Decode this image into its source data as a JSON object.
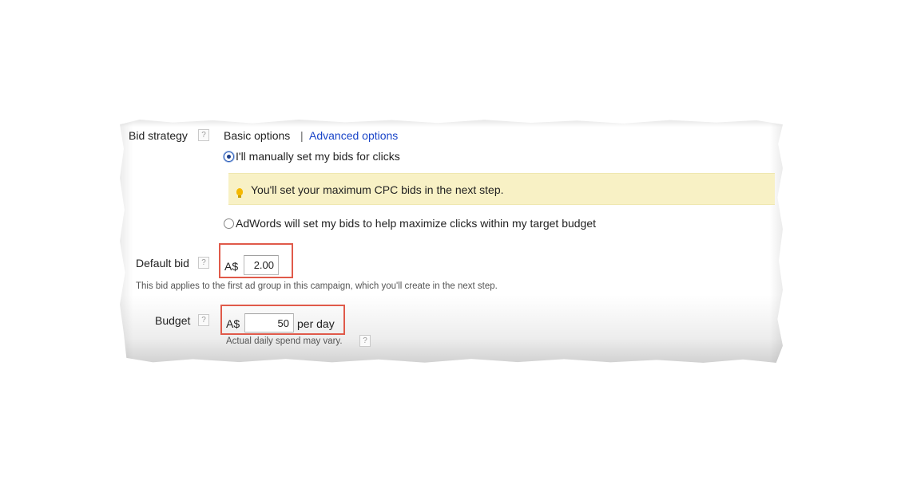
{
  "bid_strategy": {
    "label": "Bid strategy",
    "help_icon": "?",
    "tab_basic": "Basic options",
    "separator": "|",
    "tab_advanced": "Advanced options",
    "option_manual": "I'll manually set my bids for clicks",
    "notice": "You'll set your maximum CPC bids in the next step.",
    "option_auto": "AdWords will set my bids to help maximize clicks within my target budget"
  },
  "default_bid": {
    "label": "Default bid",
    "help_icon": "?",
    "currency": "A$",
    "value": "2.00",
    "note": "This bid applies to the first ad group in this campaign, which you'll create in the next step."
  },
  "budget": {
    "label": "Budget",
    "help_icon": "?",
    "currency": "A$",
    "value": "50",
    "unit": "per day",
    "note": "Actual daily spend may vary.",
    "note_help_icon": "?"
  },
  "colors": {
    "link": "#1a45c8",
    "notice_bg": "#f8f1c5",
    "highlight": "#e05a4a",
    "bulb": "#f5b800"
  }
}
